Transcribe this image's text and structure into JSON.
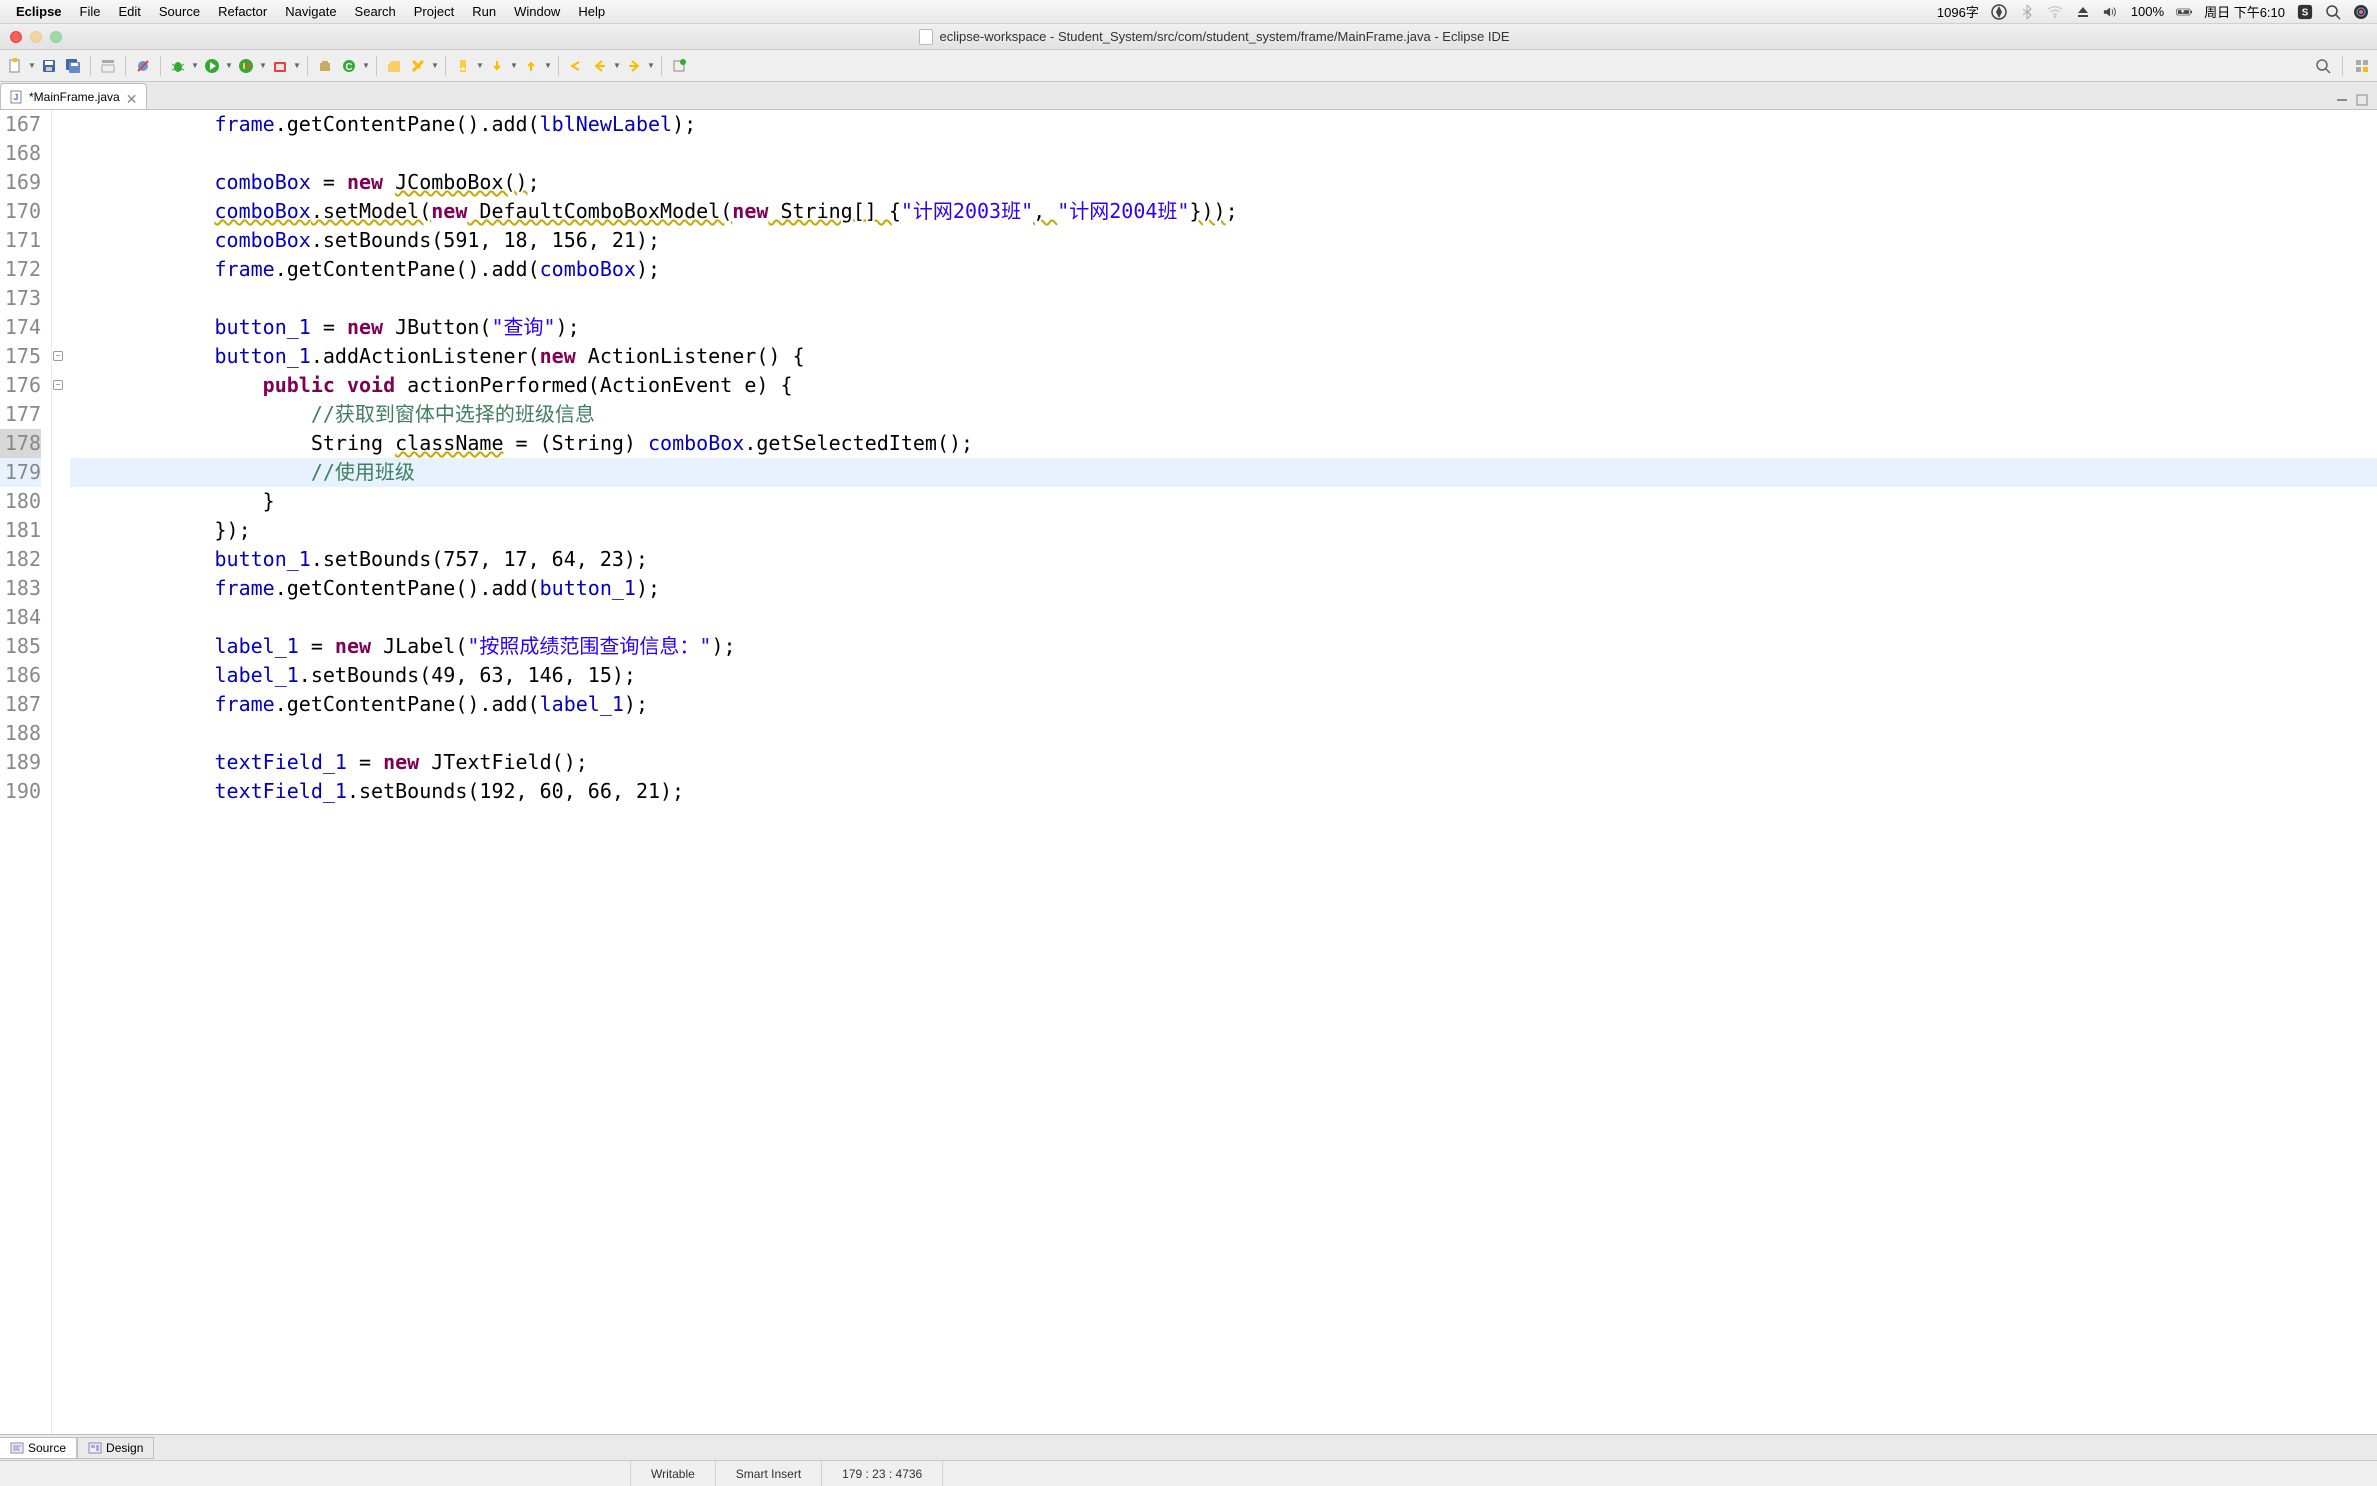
{
  "menubar": {
    "app": "Eclipse",
    "items": [
      "File",
      "Edit",
      "Source",
      "Refactor",
      "Navigate",
      "Search",
      "Project",
      "Run",
      "Window",
      "Help"
    ],
    "wordcount": "1096字",
    "battery": "100%",
    "datetime": "周日 下午6:10"
  },
  "window": {
    "title": "eclipse-workspace - Student_System/src/com/student_system/frame/MainFrame.java - Eclipse IDE"
  },
  "tab": {
    "name": "*MainFrame.java"
  },
  "code": {
    "lines": [
      {
        "n": 167,
        "indent": 3,
        "tokens": [
          {
            "t": "fld",
            "v": "frame"
          },
          {
            "t": "",
            "v": ".getContentPane().add("
          },
          {
            "t": "fld",
            "v": "lblNewLabel"
          },
          {
            "t": "",
            "v": ");"
          }
        ]
      },
      {
        "n": 168,
        "indent": 3,
        "tokens": []
      },
      {
        "n": 169,
        "indent": 3,
        "tokens": [
          {
            "t": "fld",
            "v": "comboBox"
          },
          {
            "t": "",
            "v": " = "
          },
          {
            "t": "kw",
            "v": "new"
          },
          {
            "t": "",
            "v": " "
          },
          {
            "t": "warn",
            "v": "JComboBox()"
          },
          {
            "t": "",
            "v": ";"
          }
        ]
      },
      {
        "n": 170,
        "indent": 3,
        "tokens": [
          {
            "t": "fld warn",
            "v": "comboBox"
          },
          {
            "t": "warn",
            "v": ".setModel("
          },
          {
            "t": "kw",
            "v": "new"
          },
          {
            "t": "warn",
            "v": " DefaultComboBoxModel("
          },
          {
            "t": "kw",
            "v": "new"
          },
          {
            "t": "warn",
            "v": " String[] {"
          },
          {
            "t": "str",
            "v": "\"计网2003班\""
          },
          {
            "t": "warn",
            "v": ", "
          },
          {
            "t": "str",
            "v": "\"计网2004班\""
          },
          {
            "t": "warn",
            "v": "}))"
          },
          {
            "t": "",
            "v": ";"
          }
        ]
      },
      {
        "n": 171,
        "indent": 3,
        "tokens": [
          {
            "t": "fld",
            "v": "comboBox"
          },
          {
            "t": "",
            "v": ".setBounds(591, 18, 156, 21);"
          }
        ]
      },
      {
        "n": 172,
        "indent": 3,
        "tokens": [
          {
            "t": "fld",
            "v": "frame"
          },
          {
            "t": "",
            "v": ".getContentPane().add("
          },
          {
            "t": "fld",
            "v": "comboBox"
          },
          {
            "t": "",
            "v": ");"
          }
        ]
      },
      {
        "n": 173,
        "indent": 3,
        "tokens": []
      },
      {
        "n": 174,
        "indent": 3,
        "tokens": [
          {
            "t": "fld",
            "v": "button_1"
          },
          {
            "t": "",
            "v": " = "
          },
          {
            "t": "kw",
            "v": "new"
          },
          {
            "t": "",
            "v": " JButton("
          },
          {
            "t": "str",
            "v": "\"查询\""
          },
          {
            "t": "",
            "v": ");"
          }
        ]
      },
      {
        "n": 175,
        "indent": 3,
        "fold": true,
        "tokens": [
          {
            "t": "fld",
            "v": "button_1"
          },
          {
            "t": "",
            "v": ".addActionListener("
          },
          {
            "t": "kw",
            "v": "new"
          },
          {
            "t": "",
            "v": " ActionListener() {"
          }
        ]
      },
      {
        "n": 176,
        "indent": 4,
        "fold": true,
        "tokens": [
          {
            "t": "kw",
            "v": "public"
          },
          {
            "t": "",
            "v": " "
          },
          {
            "t": "kw",
            "v": "void"
          },
          {
            "t": "",
            "v": " actionPerformed(ActionEvent "
          },
          {
            "t": "",
            "v": "e"
          },
          {
            "t": "",
            "v": ") {"
          }
        ]
      },
      {
        "n": 177,
        "indent": 5,
        "tokens": [
          {
            "t": "com",
            "v": "//获取到窗体中选择的班级信息"
          }
        ]
      },
      {
        "n": 178,
        "indent": 5,
        "sel": true,
        "tokens": [
          {
            "t": "",
            "v": "String "
          },
          {
            "t": "warn",
            "v": "className"
          },
          {
            "t": "",
            "v": " = (String) "
          },
          {
            "t": "fld",
            "v": "comboBox"
          },
          {
            "t": "",
            "v": ".getSelectedItem();"
          }
        ]
      },
      {
        "n": 179,
        "indent": 5,
        "hl": true,
        "tokens": [
          {
            "t": "com",
            "v": "//使用班级"
          }
        ]
      },
      {
        "n": 180,
        "indent": 4,
        "tokens": [
          {
            "t": "",
            "v": "}"
          }
        ]
      },
      {
        "n": 181,
        "indent": 3,
        "tokens": [
          {
            "t": "",
            "v": "});"
          }
        ]
      },
      {
        "n": 182,
        "indent": 3,
        "tokens": [
          {
            "t": "fld",
            "v": "button_1"
          },
          {
            "t": "",
            "v": ".setBounds(757, 17, 64, 23);"
          }
        ]
      },
      {
        "n": 183,
        "indent": 3,
        "tokens": [
          {
            "t": "fld",
            "v": "frame"
          },
          {
            "t": "",
            "v": ".getContentPane().add("
          },
          {
            "t": "fld",
            "v": "button_1"
          },
          {
            "t": "",
            "v": ");"
          }
        ]
      },
      {
        "n": 184,
        "indent": 3,
        "tokens": []
      },
      {
        "n": 185,
        "indent": 3,
        "tokens": [
          {
            "t": "fld",
            "v": "label_1"
          },
          {
            "t": "",
            "v": " = "
          },
          {
            "t": "kw",
            "v": "new"
          },
          {
            "t": "",
            "v": " JLabel("
          },
          {
            "t": "str",
            "v": "\"按照成绩范围查询信息：\""
          },
          {
            "t": "",
            "v": ");"
          }
        ]
      },
      {
        "n": 186,
        "indent": 3,
        "tokens": [
          {
            "t": "fld",
            "v": "label_1"
          },
          {
            "t": "",
            "v": ".setBounds(49, 63, 146, 15);"
          }
        ]
      },
      {
        "n": 187,
        "indent": 3,
        "tokens": [
          {
            "t": "fld",
            "v": "frame"
          },
          {
            "t": "",
            "v": ".getContentPane().add("
          },
          {
            "t": "fld",
            "v": "label_1"
          },
          {
            "t": "",
            "v": ");"
          }
        ]
      },
      {
        "n": 188,
        "indent": 3,
        "tokens": []
      },
      {
        "n": 189,
        "indent": 3,
        "tokens": [
          {
            "t": "fld",
            "v": "textField_1"
          },
          {
            "t": "",
            "v": " = "
          },
          {
            "t": "kw",
            "v": "new"
          },
          {
            "t": "",
            "v": " JTextField();"
          }
        ]
      },
      {
        "n": 190,
        "indent": 3,
        "tokens": [
          {
            "t": "fld",
            "v": "textField_1"
          },
          {
            "t": "",
            "v": ".setBounds(192, 60, 66, 21);"
          }
        ]
      }
    ]
  },
  "bottom_tabs": {
    "source": "Source",
    "design": "Design"
  },
  "status": {
    "writable": "Writable",
    "insert": "Smart Insert",
    "position": "179 : 23 : 4736"
  }
}
